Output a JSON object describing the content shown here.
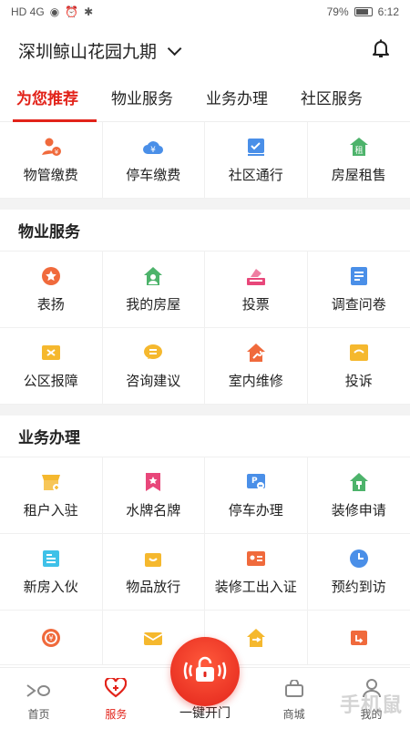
{
  "status": {
    "battery": "79%",
    "time": "6:12",
    "left": "HD 4G"
  },
  "header": {
    "community": "深圳鲸山花园九期"
  },
  "tabs": [
    "为您推荐",
    "物业服务",
    "业务办理",
    "社区服务"
  ],
  "recommend": [
    {
      "label": "物管缴费",
      "icon": "user-yen-icon",
      "color": "#f06a3c"
    },
    {
      "label": "停车缴费",
      "icon": "cloud-yen-icon",
      "color": "#4a8fe8"
    },
    {
      "label": "社区通行",
      "icon": "pass-icon",
      "color": "#4a8fe8"
    },
    {
      "label": "房屋租售",
      "icon": "house-rent-icon",
      "color": "#4db36b"
    }
  ],
  "sections": [
    {
      "title": "物业服务",
      "items": [
        {
          "label": "表扬",
          "icon": "star-badge-icon",
          "color": "#f06a3c"
        },
        {
          "label": "我的房屋",
          "icon": "house-user-icon",
          "color": "#4db36b"
        },
        {
          "label": "投票",
          "icon": "vote-box-icon",
          "color": "#e8477a"
        },
        {
          "label": "调查问卷",
          "icon": "survey-icon",
          "color": "#4a8fe8"
        },
        {
          "label": "公区报障",
          "icon": "repair-ticket-icon",
          "color": "#f5b82e"
        },
        {
          "label": "咨询建议",
          "icon": "chat-icon",
          "color": "#f5b82e"
        },
        {
          "label": "室内维修",
          "icon": "house-wrench-icon",
          "color": "#f06a3c"
        },
        {
          "label": "投诉",
          "icon": "complaint-icon",
          "color": "#f5b82e"
        }
      ]
    },
    {
      "title": "业务办理",
      "items": [
        {
          "label": "租户入驻",
          "icon": "shop-icon",
          "color": "#f5b82e"
        },
        {
          "label": "水牌名牌",
          "icon": "banner-icon",
          "color": "#e8477a"
        },
        {
          "label": "停车办理",
          "icon": "parking-icon",
          "color": "#4a8fe8"
        },
        {
          "label": "装修申请",
          "icon": "paint-house-icon",
          "color": "#4db36b"
        },
        {
          "label": "新房入伙",
          "icon": "document-icon",
          "color": "#3fc1e8"
        },
        {
          "label": "物品放行",
          "icon": "bag-icon",
          "color": "#f5b82e"
        },
        {
          "label": "装修工出入证",
          "icon": "id-card-icon",
          "color": "#f06a3c"
        },
        {
          "label": "预约到访",
          "icon": "clock-icon",
          "color": "#4a8fe8"
        }
      ]
    }
  ],
  "partial_row": [
    {
      "icon": "coin-icon",
      "color": "#f06a3c"
    },
    {
      "icon": "mail-icon",
      "color": "#f5b82e"
    },
    {
      "icon": "transfer-icon",
      "color": "#f5b82e"
    },
    {
      "icon": "exit-icon",
      "color": "#f06a3c"
    }
  ],
  "bottom_nav": {
    "home": "首页",
    "service": "服务",
    "open_door": "一键开门",
    "mall": "商城",
    "mine": "我的"
  },
  "watermark": "手机鼠",
  "accent": "#e2231a"
}
